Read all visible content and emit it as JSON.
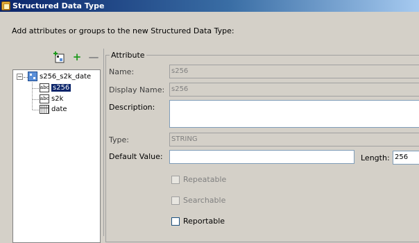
{
  "window": {
    "title": "Structured Data Type"
  },
  "instructions": "Add attributes or groups to the new Structured Data Type:",
  "toolbar": {
    "add_group_icon": "add-group-icon",
    "add_attribute_symbol": "+",
    "remove_symbol": "—"
  },
  "tree": {
    "root": {
      "label": "s256_s2k_date",
      "expander": "−",
      "icon": "structured-type-icon"
    },
    "children": [
      {
        "label": "s256",
        "icon": "text-attribute-icon",
        "icon_text": "abc",
        "selected": true
      },
      {
        "label": "s2k",
        "icon": "text-attribute-icon",
        "icon_text": "abc",
        "selected": false
      },
      {
        "label": "date",
        "icon": "date-grid-icon",
        "selected": false
      }
    ]
  },
  "attribute": {
    "legend": "Attribute",
    "name_label": "Name:",
    "name_value": "s256",
    "display_name_label": "Display Name:",
    "display_name_value": "s256",
    "description_label": "Description:",
    "description_value": "",
    "type_label": "Type:",
    "type_value": "STRING",
    "default_value_label": "Default Value:",
    "default_value": "",
    "length_label": "Length:",
    "length_value": "256",
    "repeatable_label": "Repeatable",
    "searchable_label": "Searchable",
    "reportable_label": "Reportable"
  },
  "colors": {
    "selection": "#0a246a",
    "window_bg": "#d4d0c8"
  }
}
